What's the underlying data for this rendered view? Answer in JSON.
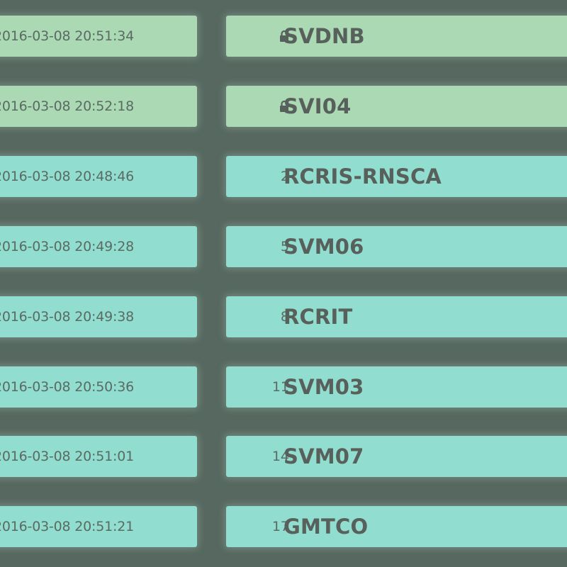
{
  "colors": {
    "page_background": "#56685f",
    "locked_row": "#abd9b4",
    "open_row": "#91ddcf",
    "text_muted": "#5a6b63",
    "text_strong": "#58605c"
  },
  "rows": [
    {
      "status": "locked",
      "icon": "lock-icon",
      "time": "2016-03-08 20:51:34",
      "number": "",
      "name": "SVDNB"
    },
    {
      "status": "locked",
      "icon": "lock-icon",
      "time": "2016-03-08 20:52:18",
      "number": "",
      "name": "SVI04"
    },
    {
      "status": "open",
      "icon": "",
      "time": "2016-03-08 20:48:46",
      "number": "2",
      "name": "RCRIS-RNSCA"
    },
    {
      "status": "open",
      "icon": "",
      "time": "2016-03-08 20:49:28",
      "number": "5",
      "name": "SVM06"
    },
    {
      "status": "open",
      "icon": "",
      "time": "2016-03-08 20:49:38",
      "number": "8",
      "name": "RCRIT"
    },
    {
      "status": "open",
      "icon": "",
      "time": "2016-03-08 20:50:36",
      "number": "11",
      "name": "SVM03"
    },
    {
      "status": "open",
      "icon": "",
      "time": "2016-03-08 20:51:01",
      "number": "14",
      "name": "SVM07"
    },
    {
      "status": "open",
      "icon": "",
      "time": "2016-03-08 20:51:21",
      "number": "17",
      "name": "GMTCO"
    }
  ]
}
